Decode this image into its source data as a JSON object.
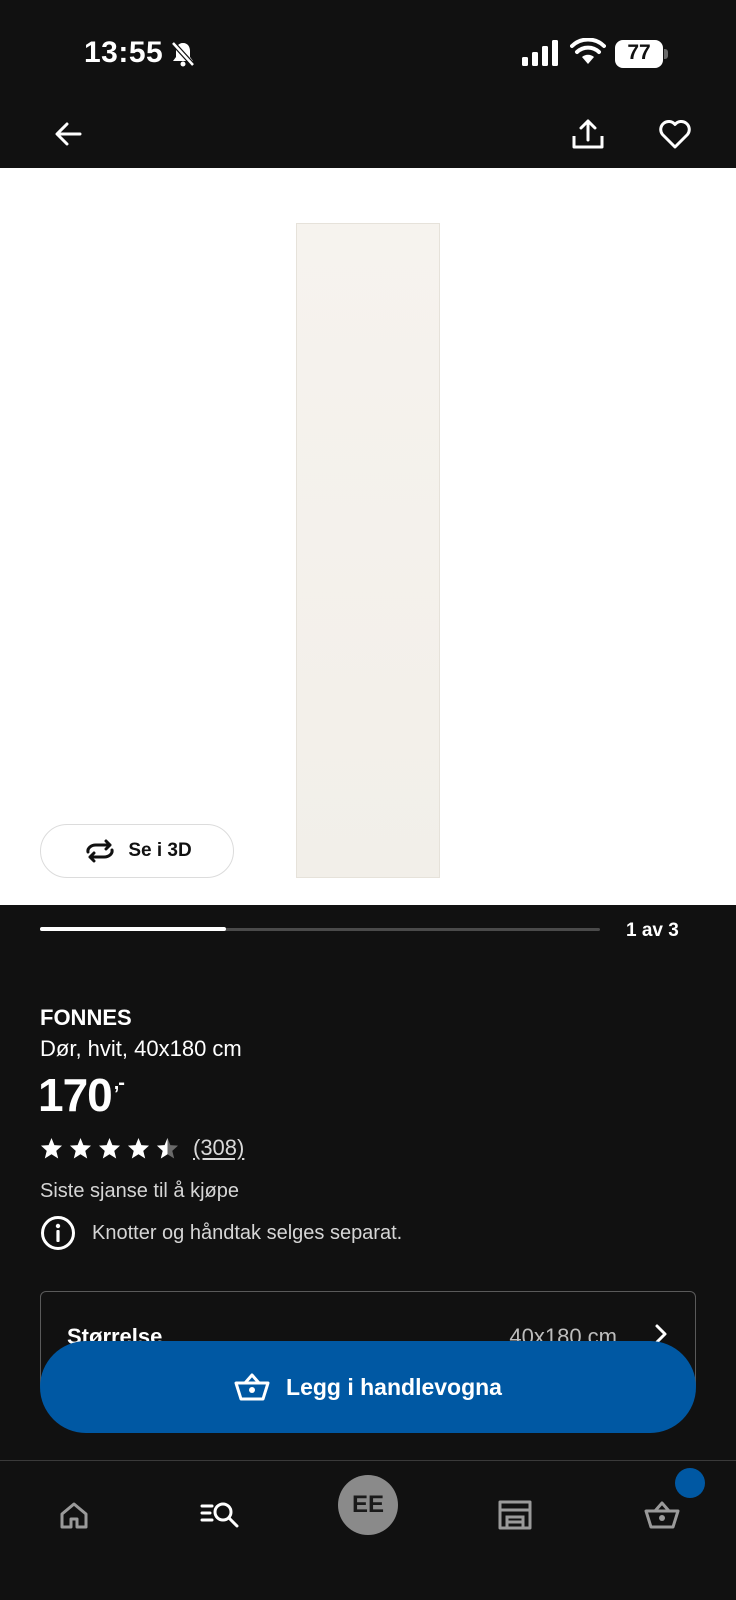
{
  "status_bar": {
    "time": "13:55",
    "battery": "77"
  },
  "header": {
    "back_icon": "arrow-left-icon",
    "share_icon": "share-icon",
    "favorite_icon": "heart-icon"
  },
  "gallery": {
    "view_3d_label": "Se i 3D",
    "counter": "1 av 3",
    "progress": 0.333
  },
  "product": {
    "name": "FONNES",
    "description": "Dør, hvit, 40x180 cm",
    "price": "170",
    "price_suffix": ",-",
    "rating": 4.5,
    "rating_count": "(308)",
    "availability": "Siste sjanse til å kjøpe",
    "info": "Knotter og håndtak selges separat."
  },
  "size_option": {
    "label": "Størrelse",
    "value": "40x180 cm"
  },
  "cta": {
    "label": "Legg i handlevogna",
    "icon": "basket-icon"
  },
  "bottom_nav": {
    "avatar_initials": "EE",
    "accent": "#0058a3"
  }
}
